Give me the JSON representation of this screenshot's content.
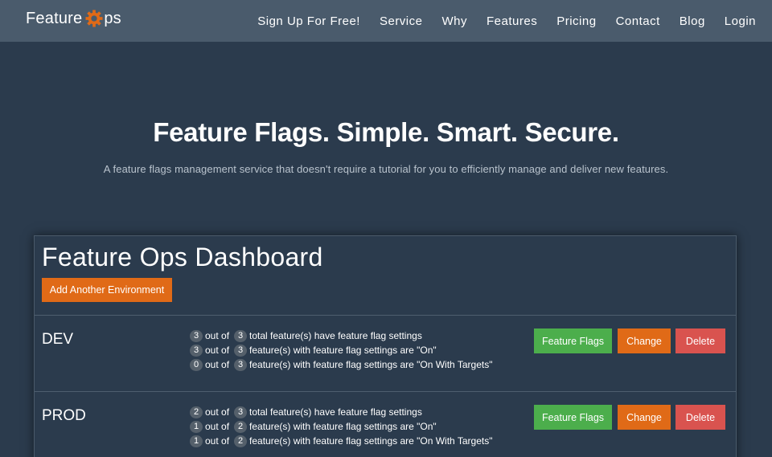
{
  "brand": {
    "text_before": "Feature ",
    "text_after": "ps",
    "gear_color": "#e06a17"
  },
  "nav": {
    "links": [
      "Sign Up For Free!",
      "Service",
      "Why",
      "Features",
      "Pricing",
      "Contact",
      "Blog",
      "Login"
    ]
  },
  "hero": {
    "title": "Feature Flags. Simple. Smart. Secure.",
    "subtitle": "A feature flags management service that doesn't require a tutorial for you to efficiently manage and deliver new features."
  },
  "dashboard": {
    "title": "Feature Ops Dashboard",
    "add_button": "Add Another Environment",
    "environments": [
      {
        "name": "DEV",
        "stats": [
          {
            "count": "3",
            "mid": "out of",
            "total": "3",
            "text": "total feature(s) have feature flag settings"
          },
          {
            "count": "3",
            "mid": "out of",
            "total": "3",
            "text": "feature(s) with feature flag settings are \"On\""
          },
          {
            "count": "0",
            "mid": "out of",
            "total": "3",
            "text": "feature(s) with feature flag settings are \"On With Targets\""
          }
        ],
        "buttons": {
          "flags": "Feature Flags",
          "change": "Change",
          "delete": "Delete"
        }
      },
      {
        "name": "PROD",
        "stats": [
          {
            "count": "2",
            "mid": "out of",
            "total": "3",
            "text": "total feature(s) have feature flag settings"
          },
          {
            "count": "1",
            "mid": "out of",
            "total": "2",
            "text": "feature(s) with feature flag settings are \"On\""
          },
          {
            "count": "1",
            "mid": "out of",
            "total": "2",
            "text": "feature(s) with feature flag settings are \"On With Targets\""
          }
        ],
        "buttons": {
          "flags": "Feature Flags",
          "change": "Change",
          "delete": "Delete"
        }
      }
    ]
  },
  "colors": {
    "background": "#2b3b4d",
    "navbar": "#4a5b6c",
    "accent_orange": "#e06a17",
    "success_green": "#4cae4c",
    "danger_red": "#d9534f"
  }
}
